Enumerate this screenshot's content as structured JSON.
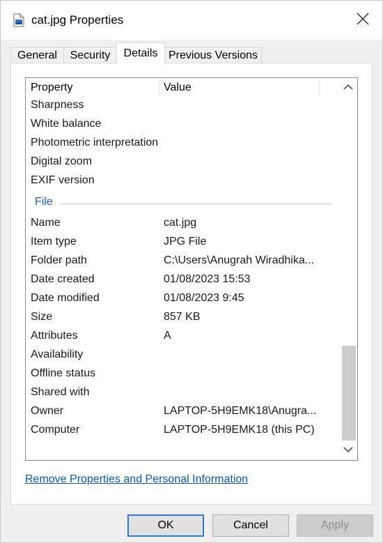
{
  "window": {
    "title": "cat.jpg Properties",
    "icon": "image-file-icon",
    "close_icon": "close-icon"
  },
  "tabs": [
    {
      "label": "General",
      "active": false
    },
    {
      "label": "Security",
      "active": false
    },
    {
      "label": "Details",
      "active": true
    },
    {
      "label": "Previous Versions",
      "active": false
    }
  ],
  "details": {
    "columns": {
      "property": "Property",
      "value": "Value"
    },
    "rows_top": [
      {
        "property": "Sharpness",
        "value": ""
      },
      {
        "property": "White balance",
        "value": ""
      },
      {
        "property": "Photometric interpretation",
        "value": ""
      },
      {
        "property": "Digital zoom",
        "value": ""
      },
      {
        "property": "EXIF version",
        "value": ""
      }
    ],
    "group_file": "File",
    "rows_file": [
      {
        "property": "Name",
        "value": "cat.jpg"
      },
      {
        "property": "Item type",
        "value": "JPG File"
      },
      {
        "property": "Folder path",
        "value": "C:\\Users\\Anugrah  Wiradhika..."
      },
      {
        "property": "Date created",
        "value": "01/08/2023 15:53"
      },
      {
        "property": "Date modified",
        "value": "01/08/2023 9:45"
      },
      {
        "property": "Size",
        "value": "857 KB"
      },
      {
        "property": "Attributes",
        "value": "A"
      },
      {
        "property": "Availability",
        "value": ""
      },
      {
        "property": "Offline status",
        "value": ""
      },
      {
        "property": "Shared with",
        "value": ""
      },
      {
        "property": "Owner",
        "value": "LAPTOP-5H9EMK18\\Anugra..."
      },
      {
        "property": "Computer",
        "value": "LAPTOP-5H9EMK18 (this PC)"
      }
    ]
  },
  "scroll": {
    "position_fraction": 1.0
  },
  "link": {
    "remove_properties": "Remove Properties and Personal Information"
  },
  "buttons": {
    "ok": "OK",
    "cancel": "Cancel",
    "apply": "Apply",
    "apply_enabled": false
  },
  "colors": {
    "accent": "#2c7bd6",
    "link": "#0c57a8",
    "group_header": "#1e5bb8"
  }
}
